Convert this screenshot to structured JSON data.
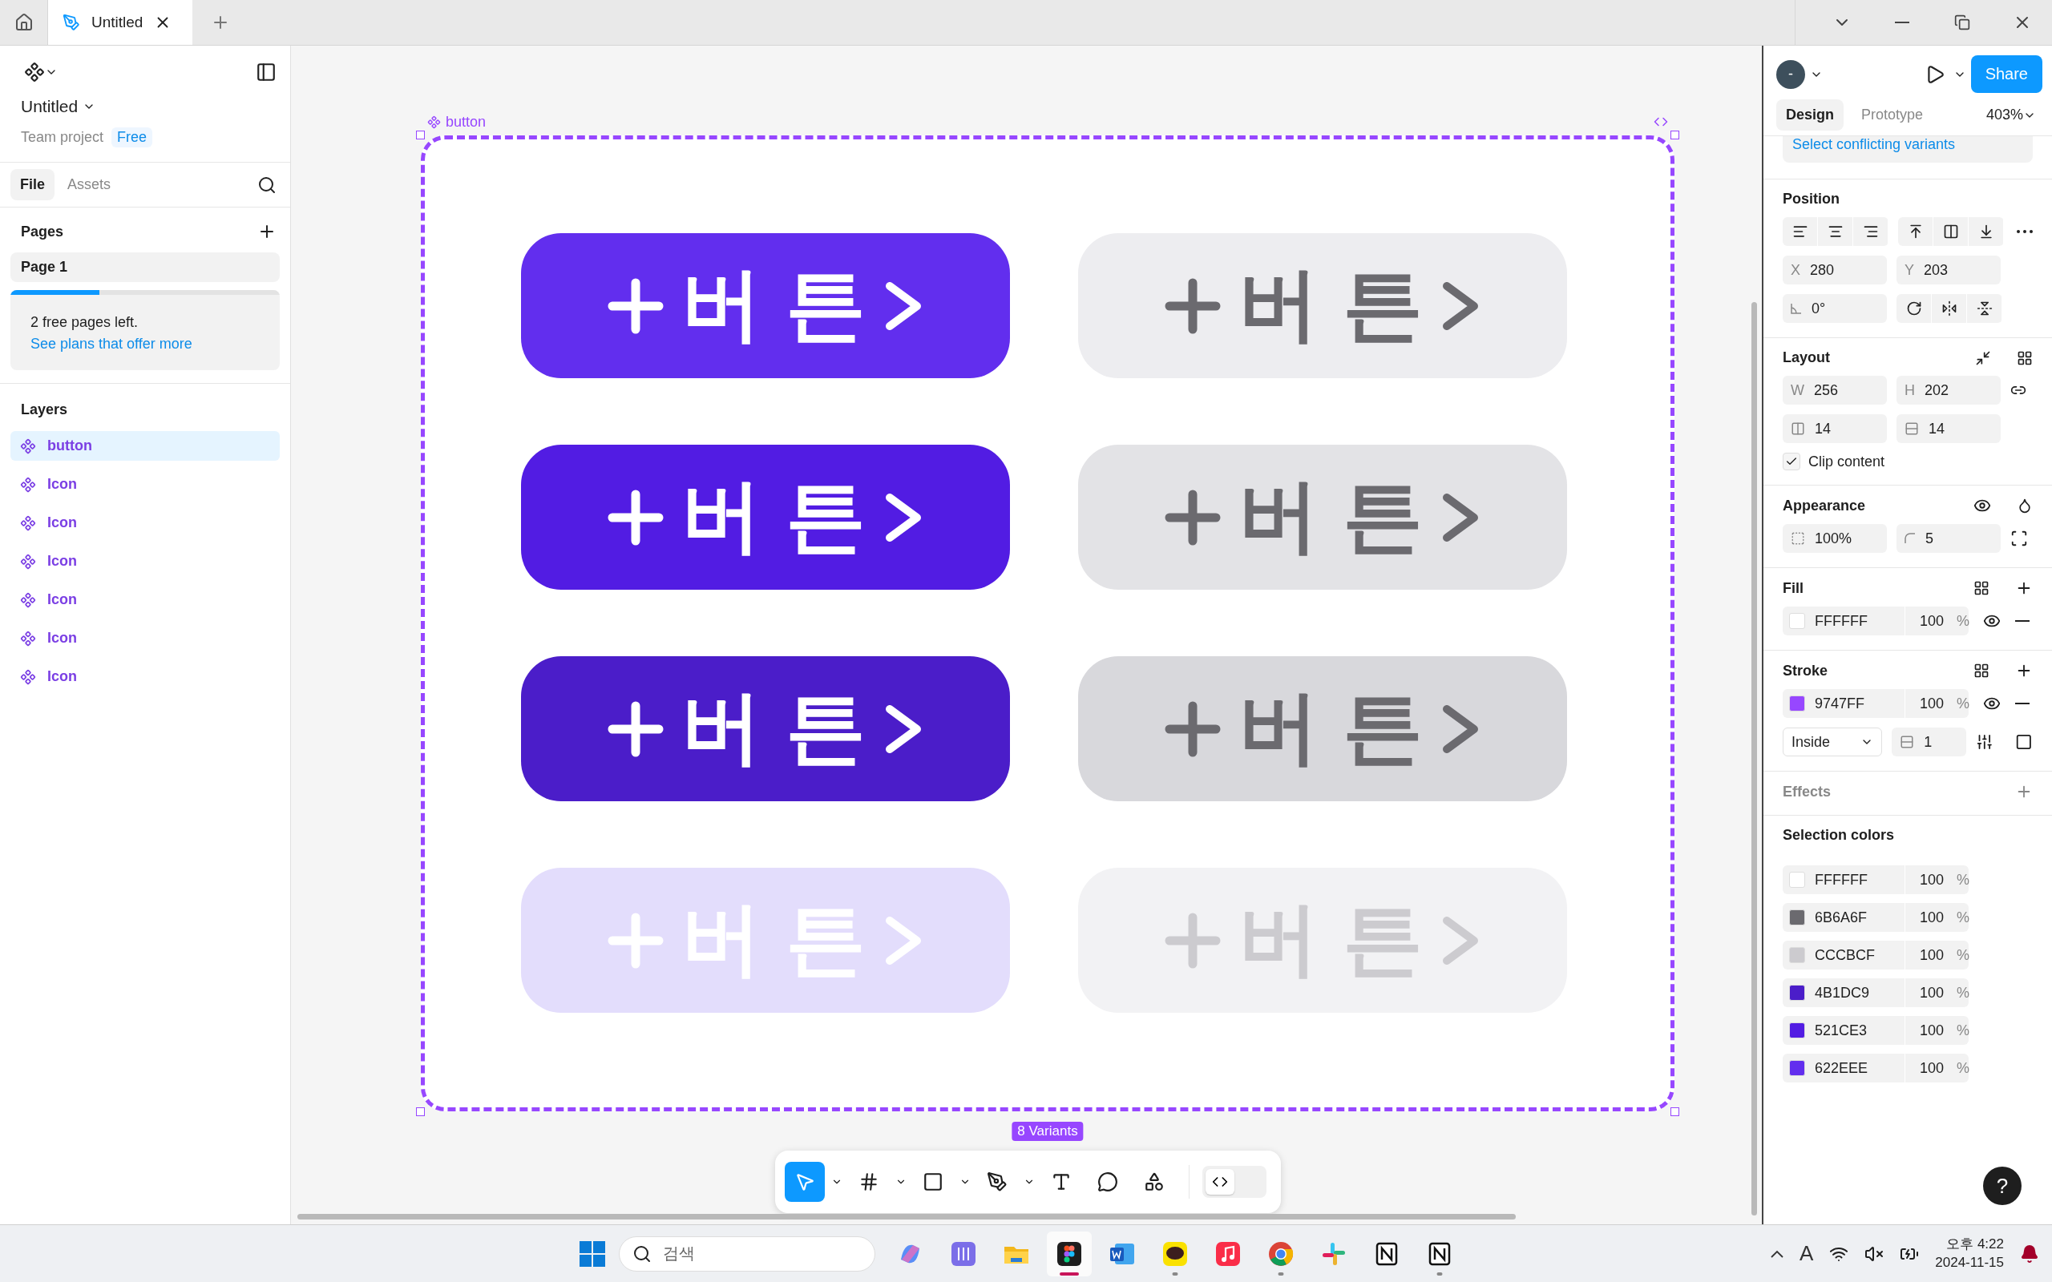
{
  "file_tab": {
    "label": "Untitled"
  },
  "file": {
    "name": "Untitled",
    "project": "Team project",
    "plan": "Free"
  },
  "panel_tabs": [
    {
      "label": "File",
      "selected": true
    },
    {
      "label": "Assets",
      "selected": false
    }
  ],
  "pages": {
    "title": "Pages",
    "items": [
      {
        "label": "Page 1",
        "selected": true
      }
    ],
    "quota": {
      "level": 0.33,
      "message": "2 free pages left.",
      "link": "See plans that offer more"
    }
  },
  "layers": {
    "title": "Layers",
    "items": [
      {
        "label": "button",
        "selected": true
      },
      {
        "label": "Icon",
        "selected": false
      },
      {
        "label": "Icon",
        "selected": false
      },
      {
        "label": "Icon",
        "selected": false
      },
      {
        "label": "Icon",
        "selected": false
      },
      {
        "label": "Icon",
        "selected": false
      },
      {
        "label": "Icon",
        "selected": false
      }
    ]
  },
  "canvas": {
    "frame_label": "button",
    "badge": "8 Variants",
    "variants": [
      {
        "label": "버튼",
        "kind": "light",
        "color": "#622eee"
      },
      {
        "label": "버튼",
        "kind": "dark",
        "color": "#ededf0"
      },
      {
        "label": "버튼",
        "kind": "light",
        "color": "#521ce3"
      },
      {
        "label": "버튼",
        "kind": "dark",
        "color": "#e3e3e6"
      },
      {
        "label": "버튼",
        "kind": "light",
        "color": "#4b1dc9"
      },
      {
        "label": "버튼",
        "kind": "dark",
        "color": "#d8d8dc"
      },
      {
        "label": "버튼",
        "kind": "light",
        "color": "#e3ddfc"
      },
      {
        "label": "버튼",
        "kind": "faint",
        "color": "#f2f2f4"
      }
    ]
  },
  "toolbar": {
    "tools": [
      {
        "kind": "move",
        "selected": true
      },
      {
        "kind": "frame",
        "selected": false
      },
      {
        "kind": "shape",
        "selected": false
      },
      {
        "kind": "pen",
        "selected": false
      },
      {
        "kind": "text",
        "selected": false
      },
      {
        "kind": "comment",
        "selected": false
      },
      {
        "kind": "actions",
        "selected": false
      }
    ],
    "dev_mode": {
      "on": false
    }
  },
  "inspector": {
    "avatar": "-",
    "share": "Share",
    "tabs": [
      {
        "label": "Design",
        "selected": true
      },
      {
        "label": "Prototype",
        "selected": false
      }
    ],
    "zoom": "403%",
    "conflict_link": "Select conflicting variants",
    "position": {
      "title": "Position",
      "x": {
        "label": "X",
        "value": "280"
      },
      "y": {
        "label": "Y",
        "value": "203"
      },
      "rotation": "0°"
    },
    "layout": {
      "title": "Layout",
      "w": {
        "label": "W",
        "value": "256"
      },
      "h": {
        "label": "H",
        "value": "202"
      },
      "gap_h": "14",
      "gap_v": "14",
      "clip": {
        "label": "Clip content",
        "checked": true
      }
    },
    "appearance": {
      "title": "Appearance",
      "opacity": "100%",
      "radius": "5"
    },
    "fill": {
      "title": "Fill",
      "items": [
        {
          "hex": "FFFFFF",
          "color": "#ffffff",
          "opacity": "100",
          "unit": "%"
        }
      ]
    },
    "stroke": {
      "title": "Stroke",
      "items": [
        {
          "hex": "9747FF",
          "color": "#9747ff",
          "opacity": "100",
          "unit": "%"
        }
      ],
      "position": "Inside",
      "weight": "1"
    },
    "effects": {
      "title": "Effects"
    },
    "selection_colors": {
      "title": "Selection colors",
      "items": [
        {
          "hex": "FFFFFF",
          "color": "#ffffff",
          "opacity": "100",
          "unit": "%"
        },
        {
          "hex": "6B6A6F",
          "color": "#6b6a6f",
          "opacity": "100",
          "unit": "%"
        },
        {
          "hex": "CCCBCF",
          "color": "#cccbcf",
          "opacity": "100",
          "unit": "%"
        },
        {
          "hex": "4B1DC9",
          "color": "#4b1dc9",
          "opacity": "100",
          "unit": "%"
        },
        {
          "hex": "521CE3",
          "color": "#521ce3",
          "opacity": "100",
          "unit": "%"
        },
        {
          "hex": "622EEE",
          "color": "#622eee",
          "opacity": "100",
          "unit": "%"
        }
      ]
    },
    "help": "?"
  },
  "taskbar": {
    "search_placeholder": "검색",
    "apps": [
      {
        "kind": "copilot",
        "running": false,
        "selected": false
      },
      {
        "kind": "mixer",
        "running": false,
        "selected": false
      },
      {
        "kind": "folder",
        "running": false,
        "selected": false
      },
      {
        "kind": "figma",
        "running": true,
        "selected": true
      },
      {
        "kind": "word",
        "running": false,
        "selected": false
      },
      {
        "kind": "chat",
        "running": true,
        "selected": false
      },
      {
        "kind": "music",
        "running": false,
        "selected": false
      },
      {
        "kind": "chrome",
        "running": true,
        "selected": false
      },
      {
        "kind": "slack",
        "running": false,
        "selected": false
      },
      {
        "kind": "notion",
        "running": false,
        "selected": false
      },
      {
        "kind": "notion",
        "running": true,
        "selected": false
      }
    ],
    "ime": "A",
    "time": "오후 4:22",
    "date": "2024-11-15"
  }
}
